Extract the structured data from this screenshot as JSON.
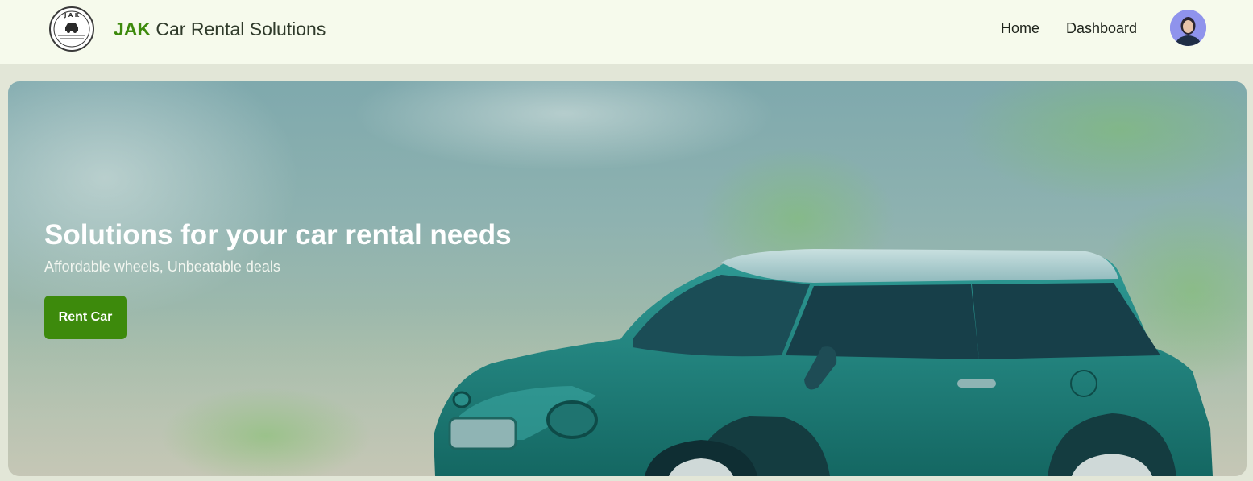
{
  "header": {
    "brand_accent": "JAK",
    "brand_rest": " Car Rental Solutions",
    "logo_icon": "jak-logo-icon",
    "nav": {
      "home": "Home",
      "dashboard": "Dashboard"
    },
    "avatar_icon": "user-avatar-icon"
  },
  "hero": {
    "title": "Solutions for your car rental needs",
    "subtitle": "Affordable wheels, Unbeatable deals",
    "button_label": "Rent Car",
    "image_icon": "toy-car-image"
  },
  "colors": {
    "brand_green": "#3d8a0c",
    "navbar_bg": "#f6faec",
    "page_bg": "#e2e6d7",
    "car_teal": "#1c7f7a"
  }
}
